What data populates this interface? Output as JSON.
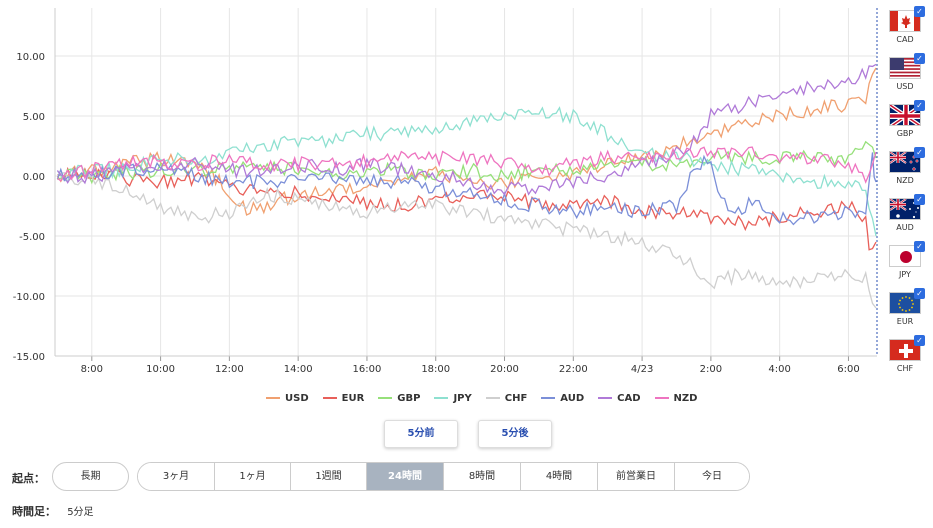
{
  "chart_data": {
    "type": "line",
    "y_ticks": [
      "10.00",
      "5.00",
      "0.00",
      "-5.00",
      "-10.00",
      "-15.00"
    ],
    "y_tick_values": [
      10,
      5,
      0,
      -5,
      -10,
      -15
    ],
    "ylim": [
      -15,
      14
    ],
    "x_ticks": [
      "8:00",
      "10:00",
      "12:00",
      "14:00",
      "16:00",
      "18:00",
      "20:00",
      "22:00",
      "4/23",
      "2:00",
      "4:00",
      "6:00"
    ],
    "x_tick_hours": [
      8,
      10,
      12,
      14,
      16,
      18,
      20,
      22,
      24,
      26,
      28,
      30
    ],
    "xlim_hours": [
      6.93,
      30.83
    ],
    "grid": true,
    "series": [
      {
        "name": "USD",
        "color": "#f0a070",
        "x": [
          7,
          8,
          9,
          10,
          11,
          11.7,
          12,
          12.5,
          13,
          14,
          15,
          16,
          17,
          18,
          19,
          20,
          21,
          22,
          23,
          24,
          25,
          26,
          27,
          28,
          29,
          30,
          30.5,
          30.8
        ],
        "values": [
          0,
          0.5,
          1,
          1.5,
          1,
          -0.3,
          -1.5,
          -2.8,
          -2.5,
          -1.5,
          -1,
          -1.2,
          -0.5,
          0.3,
          -0.5,
          -0.5,
          -0.2,
          0.3,
          1,
          1.5,
          2.5,
          3.5,
          4.5,
          5,
          5.5,
          6,
          6.5,
          9
        ]
      },
      {
        "name": "EUR",
        "color": "#e8605a",
        "x": [
          7,
          8,
          9,
          10,
          11,
          12,
          13,
          14,
          15,
          16,
          17,
          18,
          19,
          20,
          21,
          22,
          23,
          24,
          25,
          26,
          27,
          28,
          29,
          30,
          30.5,
          30.6,
          30.8
        ],
        "values": [
          0,
          0.3,
          -0.2,
          -0.5,
          -0.2,
          -1,
          -1,
          -1.5,
          -1.5,
          -2.3,
          -2.5,
          -2,
          -1.8,
          -1.7,
          -2.2,
          -2.5,
          -2,
          -3,
          -3,
          -3.5,
          -4,
          -3.5,
          -3,
          -2.5,
          -3.5,
          -6,
          -5.5
        ]
      },
      {
        "name": "GBP",
        "color": "#96e07a",
        "x": [
          7,
          8,
          9,
          10,
          11,
          12,
          13,
          14,
          15,
          16,
          17,
          18,
          19,
          20,
          21,
          22,
          23,
          24,
          25,
          26,
          27,
          28,
          29,
          30,
          30.5,
          30.8
        ],
        "values": [
          0,
          0,
          0.3,
          0.5,
          0.5,
          0.8,
          1,
          0.5,
          0,
          0.5,
          0.5,
          0,
          0.5,
          0,
          0.5,
          0.5,
          1,
          1,
          1,
          1.5,
          1.5,
          1.5,
          1.5,
          1.5,
          2.5,
          1.5
        ]
      },
      {
        "name": "JPY",
        "color": "#8ee0d0",
        "x": [
          7,
          8,
          9,
          10,
          11,
          11.8,
          12,
          13,
          14,
          15,
          16,
          17,
          18,
          19,
          20,
          21,
          22,
          23,
          24,
          25,
          26,
          27,
          28,
          29,
          30,
          30.5,
          30.8
        ],
        "values": [
          0,
          0.5,
          0.5,
          1.5,
          1.5,
          1.5,
          2.5,
          2.5,
          2.8,
          3,
          3.5,
          3.5,
          4,
          4.5,
          5,
          5.5,
          5,
          3.5,
          2,
          1.5,
          1,
          0.5,
          0,
          -0.5,
          -0.5,
          -1,
          -5
        ]
      },
      {
        "name": "CHF",
        "color": "#cfcfcf",
        "x": [
          7,
          8,
          9,
          10,
          11,
          12,
          13,
          14,
          15,
          16,
          17,
          18,
          19,
          20,
          21,
          22,
          23,
          24,
          25,
          25.5,
          26,
          26.5,
          27,
          28,
          29,
          30,
          30.5,
          30.8
        ],
        "values": [
          0,
          -0.5,
          -1,
          -2.5,
          -3.5,
          -3,
          -1.5,
          -2,
          -2.5,
          -3,
          -2.5,
          -2.5,
          -3,
          -3.5,
          -4,
          -4.5,
          -5,
          -5.5,
          -6.5,
          -7.5,
          -9,
          -8.5,
          -8,
          -9,
          -8.5,
          -8,
          -8.5,
          -11
        ]
      },
      {
        "name": "AUD",
        "color": "#7b8fd8",
        "x": [
          7,
          8,
          9,
          10,
          11,
          12,
          13,
          14,
          15,
          16,
          17,
          18,
          19,
          20,
          21,
          22,
          23,
          24,
          25,
          25.5,
          26,
          26.2,
          26.6,
          27,
          27.4,
          28,
          29,
          30,
          30.5,
          30.7,
          30.8
        ],
        "values": [
          0,
          0,
          0.5,
          0.5,
          0,
          -0.5,
          -0.5,
          -0.3,
          0,
          -0.5,
          -0.5,
          -1,
          -1.5,
          -2,
          -2.5,
          -3,
          -2.5,
          -3,
          -2.5,
          0.5,
          1.5,
          -1,
          -3,
          -2.5,
          -2,
          -3.5,
          -3.5,
          -3,
          -3,
          1.5,
          -0.5
        ]
      },
      {
        "name": "CAD",
        "color": "#b07ad8",
        "x": [
          7,
          8,
          9,
          10,
          11,
          12,
          13,
          14,
          15,
          16,
          17,
          18,
          19,
          20,
          21,
          22,
          23,
          24,
          25,
          25.5,
          26,
          27,
          28,
          29,
          30,
          30.5,
          30.8
        ],
        "values": [
          0,
          0,
          0.5,
          1,
          1,
          0.5,
          0.5,
          1,
          0.5,
          1,
          0.5,
          0,
          -0.5,
          -1,
          -1,
          -0.5,
          0,
          1,
          2,
          3,
          5,
          6,
          7,
          7.5,
          8,
          8.5,
          9.3
        ]
      },
      {
        "name": "NZD",
        "color": "#ee74c0",
        "x": [
          7,
          8,
          9,
          10,
          11,
          12,
          13,
          14,
          15,
          16,
          17,
          18,
          19,
          20,
          21,
          22,
          23,
          24,
          25,
          26,
          27,
          28,
          29,
          30,
          30.5,
          30.8
        ],
        "values": [
          0,
          0.5,
          1,
          1.2,
          1,
          1.5,
          1,
          1,
          1,
          1.2,
          1.5,
          1.5,
          1.5,
          1,
          0.5,
          1,
          1.5,
          1.5,
          2,
          2,
          2,
          1.5,
          1.5,
          1,
          0,
          2
        ]
      }
    ]
  },
  "flags": [
    {
      "code": "CAD",
      "icon": "canada-flag",
      "checked": true
    },
    {
      "code": "USD",
      "icon": "us-flag",
      "checked": true
    },
    {
      "code": "GBP",
      "icon": "uk-flag",
      "checked": true
    },
    {
      "code": "NZD",
      "icon": "nz-flag",
      "checked": true
    },
    {
      "code": "AUD",
      "icon": "au-flag",
      "checked": true
    },
    {
      "code": "JPY",
      "icon": "japan-flag",
      "checked": true
    },
    {
      "code": "EUR",
      "icon": "eu-flag",
      "checked": true
    },
    {
      "code": "CHF",
      "icon": "swiss-flag",
      "checked": true
    }
  ],
  "nav": {
    "prev": "5分前",
    "next": "5分後"
  },
  "range": {
    "origin_label": "起点：",
    "long_label": "長期",
    "buttons": [
      "3ヶ月",
      "1ヶ月",
      "1週間",
      "24時間",
      "8時間",
      "4時間",
      "前営業日",
      "今日"
    ],
    "active": "24時間"
  },
  "interval": {
    "label": "時間足：",
    "value": "5分足"
  }
}
